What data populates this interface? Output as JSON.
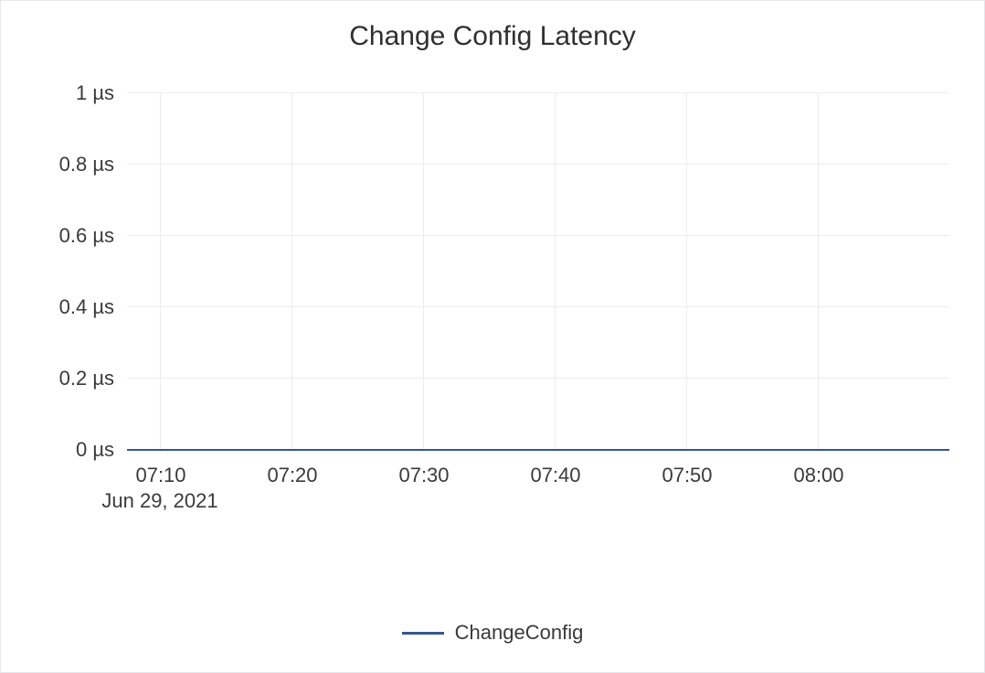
{
  "chart_data": {
    "type": "line",
    "title": "Change Config Latency",
    "x_date_label": "Jun 29, 2021",
    "x_ticks": [
      "07:10",
      "07:20",
      "07:30",
      "07:40",
      "07:50",
      "08:00"
    ],
    "y_ticks": [
      "0 µs",
      "0.2 µs",
      "0.4 µs",
      "0.6 µs",
      "0.8 µs",
      "1 µs"
    ],
    "ylim": [
      0,
      1
    ],
    "y_unit": "µs",
    "series": [
      {
        "name": "ChangeConfig",
        "color": "#34578f",
        "x": [
          "07:10",
          "07:20",
          "07:30",
          "07:40",
          "07:50",
          "08:00"
        ],
        "values": [
          0,
          0,
          0,
          0,
          0,
          0
        ]
      }
    ]
  }
}
